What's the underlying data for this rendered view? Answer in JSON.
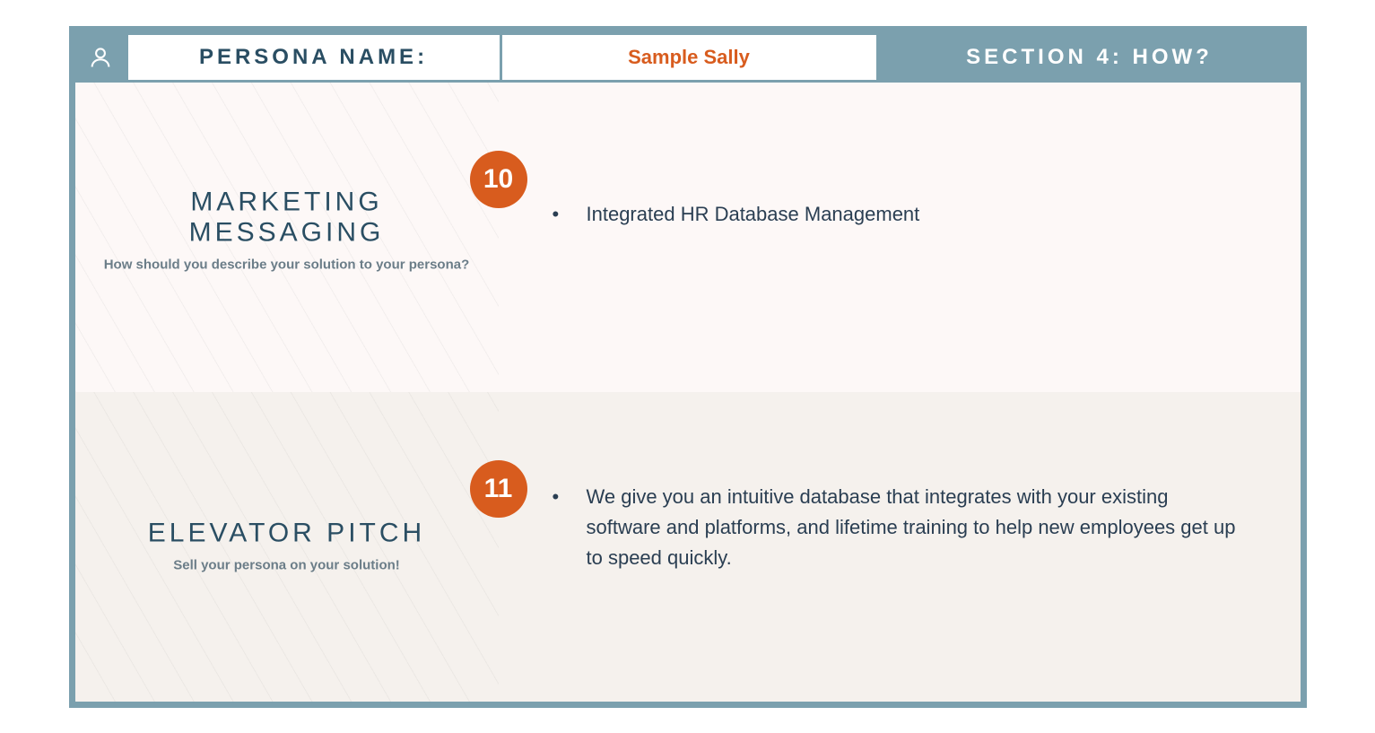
{
  "header": {
    "persona_label": "PERSONA NAME:",
    "persona_name": "Sample Sally",
    "section_label": "SECTION 4: HOW?"
  },
  "rows": [
    {
      "badge": "10",
      "title": "MARKETING MESSAGING",
      "subtitle": "How should you describe your solution to your persona?",
      "bullets": [
        "Integrated HR Database Management"
      ]
    },
    {
      "badge": "11",
      "title": "ELEVATOR PITCH",
      "subtitle": "Sell your persona on your solution!",
      "bullets": [
        "We give you an intuitive database that integrates with your existing software and platforms, and lifetime training to help new employees get up to speed quickly."
      ]
    }
  ]
}
